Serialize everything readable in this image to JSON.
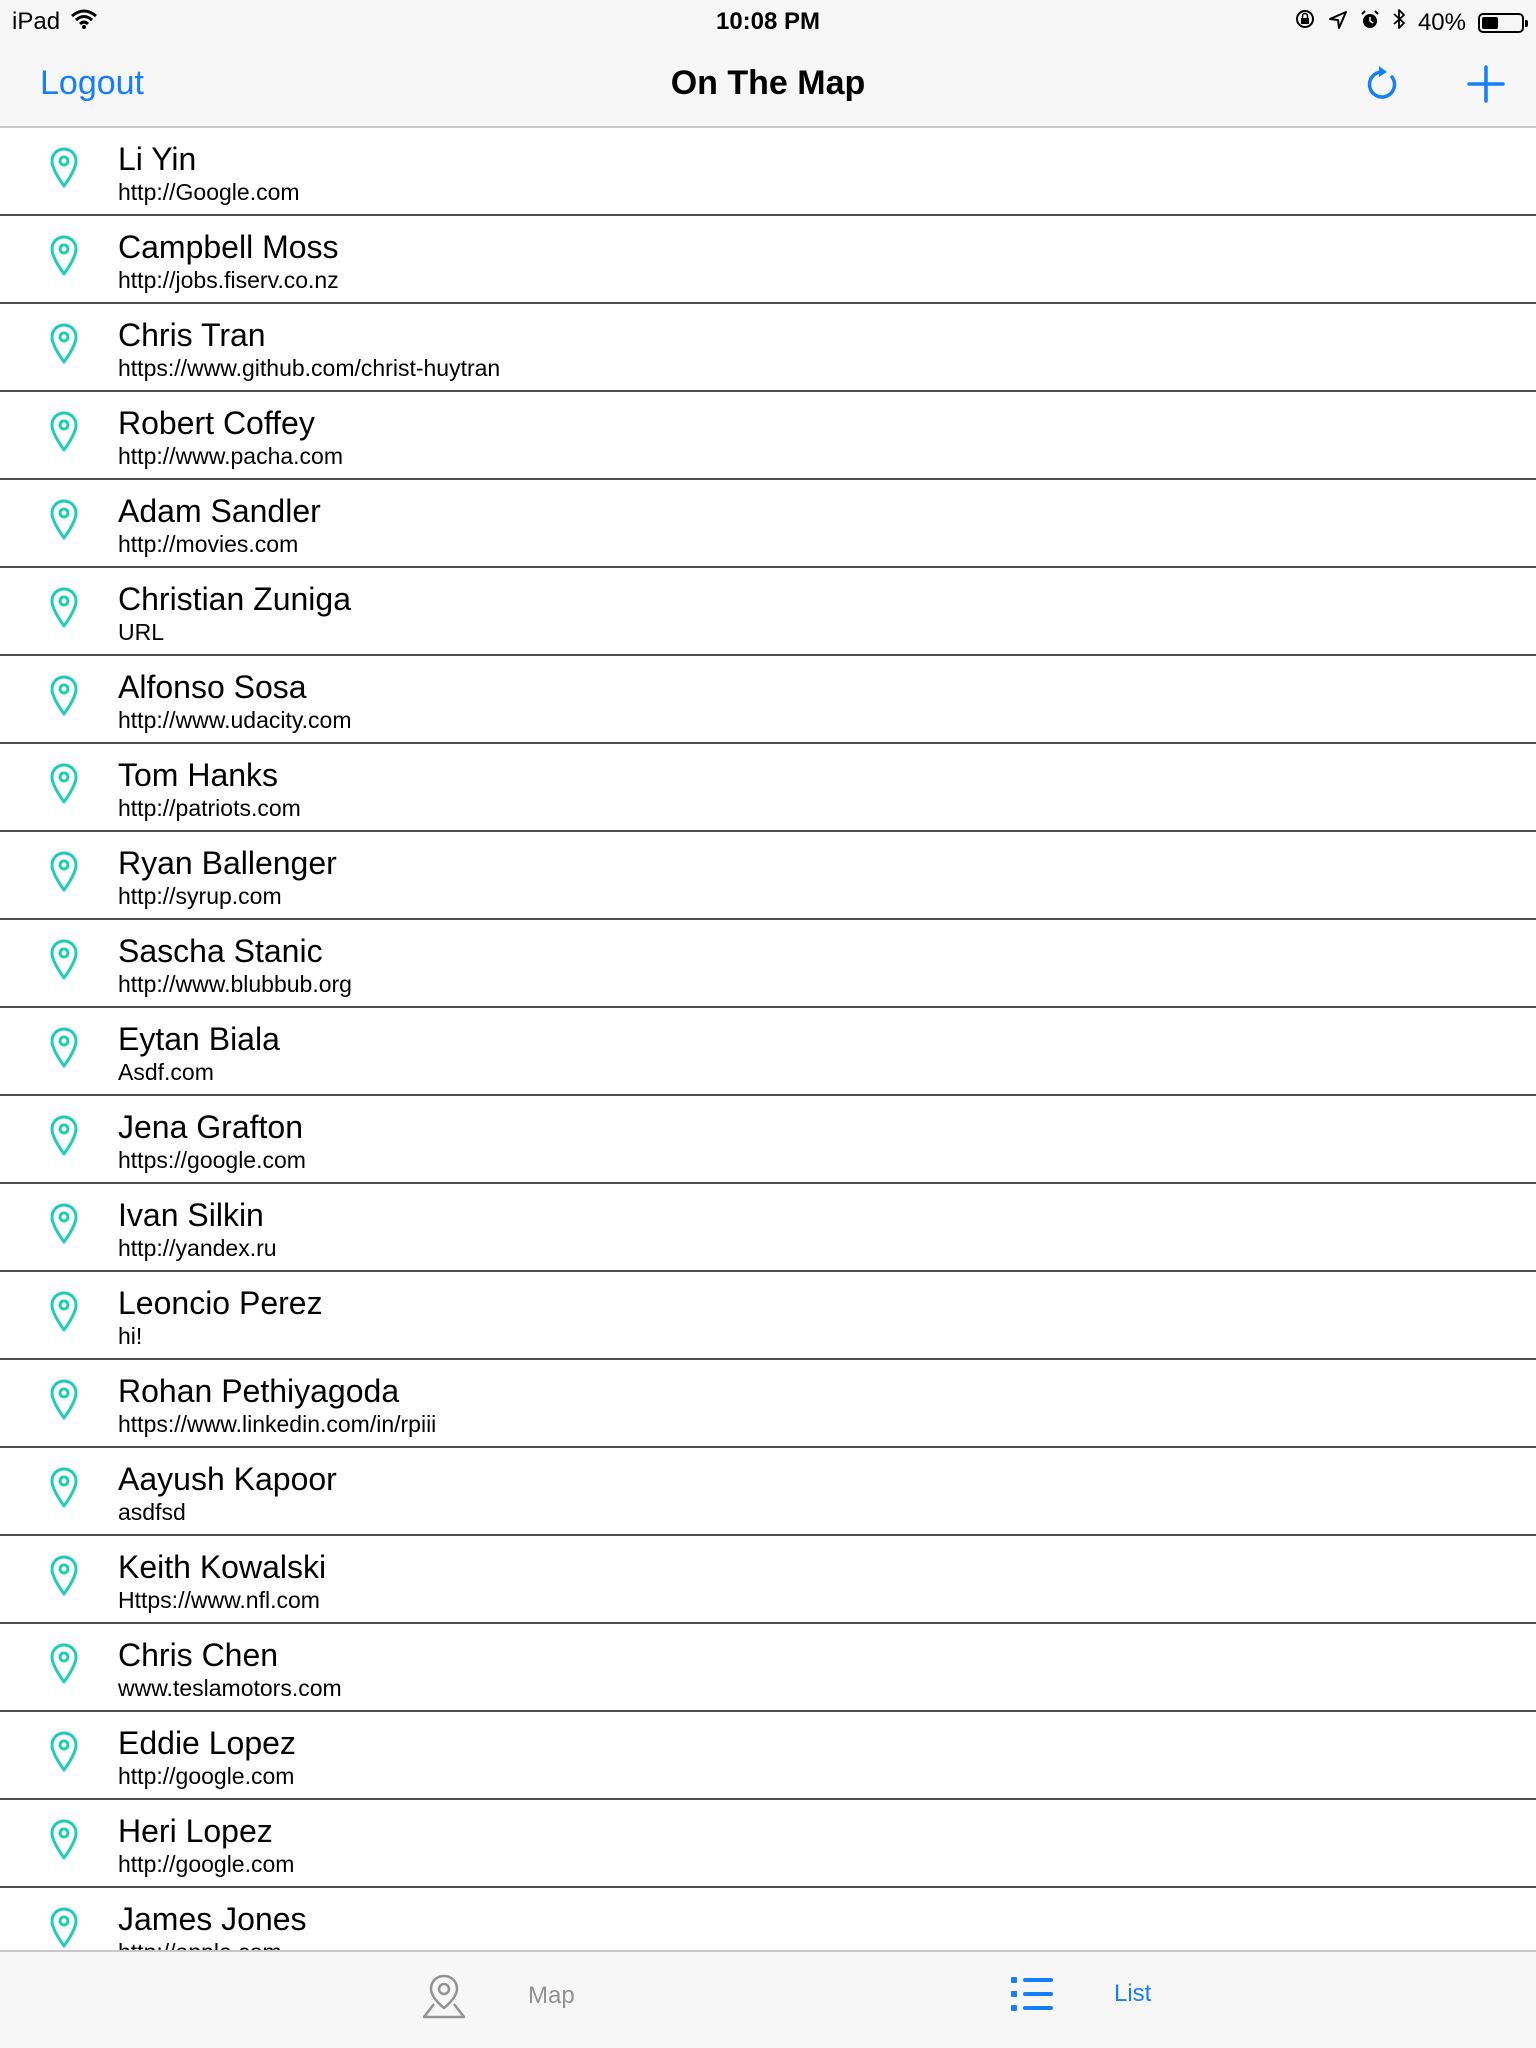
{
  "status_bar": {
    "device": "iPad",
    "time": "10:08 PM",
    "battery": "40%"
  },
  "nav": {
    "left_label": "Logout",
    "title": "On The Map"
  },
  "accent_color": "#147efb",
  "pin_color": "#1ecdb5",
  "students": [
    {
      "name": "Li Yin",
      "url": "http://Google.com"
    },
    {
      "name": "Campbell Moss",
      "url": "http://jobs.fiserv.co.nz"
    },
    {
      "name": "Chris Tran",
      "url": "https://www.github.com/christ-huytran"
    },
    {
      "name": "Robert Coffey",
      "url": "http://www.pacha.com"
    },
    {
      "name": "Adam Sandler",
      "url": "http://movies.com"
    },
    {
      "name": "Christian Zuniga",
      "url": "URL"
    },
    {
      "name": "Alfonso Sosa",
      "url": "http://www.udacity.com"
    },
    {
      "name": "Tom Hanks",
      "url": "http://patriots.com"
    },
    {
      "name": "Ryan Ballenger",
      "url": "http://syrup.com"
    },
    {
      "name": "Sascha Stanic",
      "url": "http://www.blubbub.org"
    },
    {
      "name": "Eytan Biala",
      "url": "Asdf.com"
    },
    {
      "name": "Jena Grafton",
      "url": "https://google.com"
    },
    {
      "name": "Ivan Silkin",
      "url": "http://yandex.ru"
    },
    {
      "name": "Leoncio Perez",
      "url": "hi!"
    },
    {
      "name": "Rohan Pethiyagoda",
      "url": "https://www.linkedin.com/in/rpiii"
    },
    {
      "name": "Aayush Kapoor",
      "url": "asdfsd"
    },
    {
      "name": "Keith Kowalski",
      "url": "Https://www.nfl.com"
    },
    {
      "name": "Chris Chen",
      "url": "www.teslamotors.com"
    },
    {
      "name": "Eddie Lopez",
      "url": "http://google.com"
    },
    {
      "name": "Heri Lopez",
      "url": "http://google.com"
    },
    {
      "name": "James Jones",
      "url": "http://apple.com"
    }
  ],
  "tabs": {
    "map_label": "Map",
    "list_label": "List",
    "selected": "List"
  }
}
